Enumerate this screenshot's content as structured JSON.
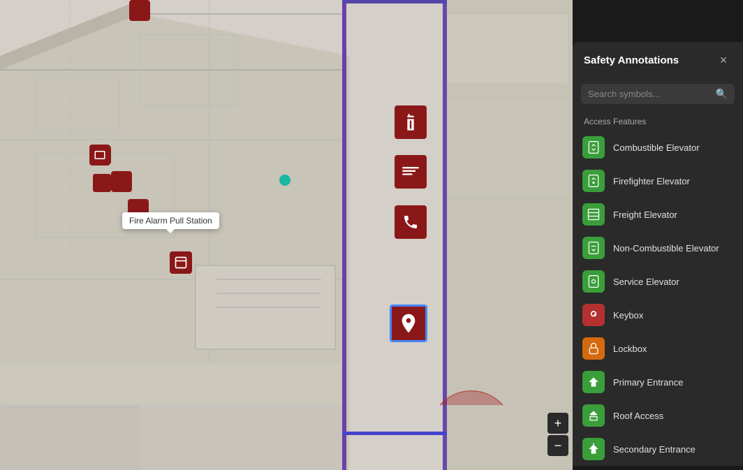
{
  "panel": {
    "title": "Safety Annotations",
    "close_label": "×",
    "search": {
      "placeholder": "Search symbols..."
    },
    "section_label": "Access Features",
    "items": [
      {
        "id": "combustible-elevator",
        "label": "Combustible Elevator",
        "icon_type": "green",
        "icon_symbol": "elevator"
      },
      {
        "id": "firefighter-elevator",
        "label": "Firefighter Elevator",
        "icon_type": "green",
        "icon_symbol": "elevator2"
      },
      {
        "id": "freight-elevator",
        "label": "Freight Elevator",
        "icon_type": "green",
        "icon_symbol": "freight"
      },
      {
        "id": "non-combustible-elevator",
        "label": "Non-Combustible Elevator",
        "icon_type": "green",
        "icon_symbol": "elevator3"
      },
      {
        "id": "service-elevator",
        "label": "Service Elevator",
        "icon_type": "green",
        "icon_symbol": "elevator4"
      },
      {
        "id": "keybox",
        "label": "Keybox",
        "icon_type": "red",
        "icon_symbol": "key"
      },
      {
        "id": "lockbox",
        "label": "Lockbox",
        "icon_type": "orange",
        "icon_symbol": "lock"
      },
      {
        "id": "primary-entrance",
        "label": "Primary Entrance",
        "icon_type": "green",
        "icon_symbol": "entrance-up"
      },
      {
        "id": "roof-access",
        "label": "Roof Access",
        "icon_type": "green",
        "icon_symbol": "roof"
      },
      {
        "id": "secondary-entrance",
        "label": "Secondary Entrance",
        "icon_type": "green",
        "icon_symbol": "entrance-up2"
      }
    ]
  },
  "map": {
    "tooltip": "Fire Alarm Pull Station"
  },
  "zoom_controls": {
    "plus": "+",
    "minus": "−"
  }
}
